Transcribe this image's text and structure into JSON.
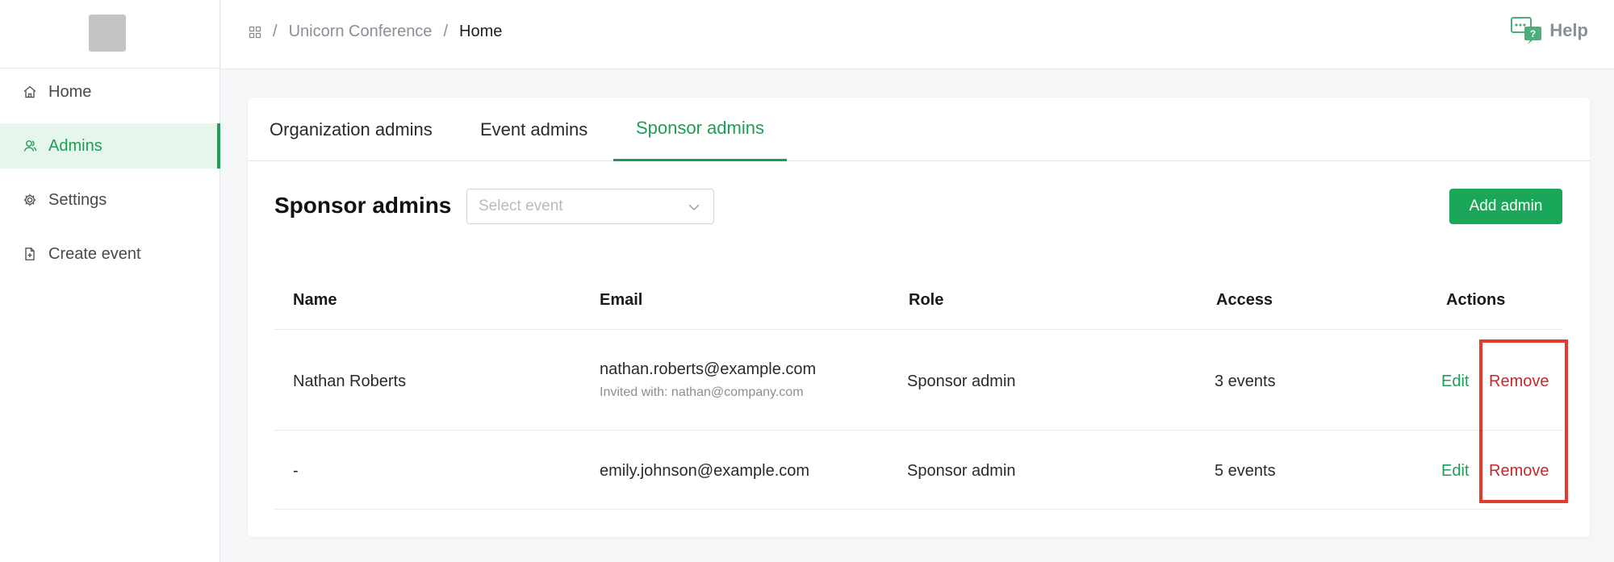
{
  "sidebar": {
    "items": [
      {
        "label": "Home",
        "icon": "home-icon",
        "active": false
      },
      {
        "label": "Admins",
        "icon": "users-icon",
        "active": true
      },
      {
        "label": "Settings",
        "icon": "gear-icon",
        "active": false
      },
      {
        "label": "Create event",
        "icon": "file-plus-icon",
        "active": false
      }
    ]
  },
  "breadcrumb": {
    "separator": "/",
    "items": [
      "Unicorn Conference",
      "Home"
    ]
  },
  "header": {
    "help_label": "Help"
  },
  "tabs": [
    {
      "label": "Organization admins",
      "active": false
    },
    {
      "label": "Event admins",
      "active": false
    },
    {
      "label": "Sponsor admins",
      "active": true
    }
  ],
  "main": {
    "title": "Sponsor admins",
    "select_placeholder": "Select event",
    "add_button": "Add admin"
  },
  "table": {
    "columns": [
      "Name",
      "Email",
      "Role",
      "Access",
      "Actions"
    ],
    "rows": [
      {
        "name": "Nathan Roberts",
        "email": "nathan.roberts@example.com",
        "invited": "Invited with: nathan@company.com",
        "role": "Sponsor admin",
        "access": "3 events",
        "edit": "Edit",
        "remove": "Remove"
      },
      {
        "name": "-",
        "email": "emily.johnson@example.com",
        "invited": "",
        "role": "Sponsor admin",
        "access": "5 events",
        "edit": "Edit",
        "remove": "Remove"
      }
    ]
  },
  "colors": {
    "accent": "#1f9d57",
    "danger": "#c62828",
    "highlight": "#e23b2e"
  }
}
